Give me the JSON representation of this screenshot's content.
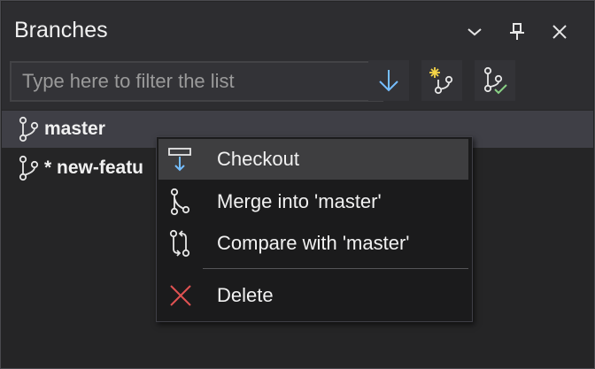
{
  "panel": {
    "title": "Branches",
    "buttons": [
      "chevron-down-icon",
      "pin-icon",
      "close-icon"
    ]
  },
  "toolbar": {
    "filter_placeholder": "Type here to filter the list",
    "tools": [
      "pull-arrow-icon",
      "new-branch-icon",
      "branch-check-icon"
    ]
  },
  "branches": [
    {
      "label": "master",
      "selected": true
    },
    {
      "label": "* new-featu",
      "selected": false
    }
  ],
  "context_menu": {
    "items": [
      {
        "label": "Checkout",
        "icon": "checkout-icon",
        "hovered": true
      },
      {
        "label": "Merge into 'master'",
        "icon": "merge-icon"
      },
      {
        "label": "Compare with 'master'",
        "icon": "compare-icon"
      },
      {
        "label": "Delete",
        "icon": "delete-icon"
      }
    ]
  },
  "colors": {
    "accent_blue": "#75beff",
    "delete_red": "#e05252",
    "check_green": "#89d185",
    "star_yellow": "#f5d547"
  }
}
